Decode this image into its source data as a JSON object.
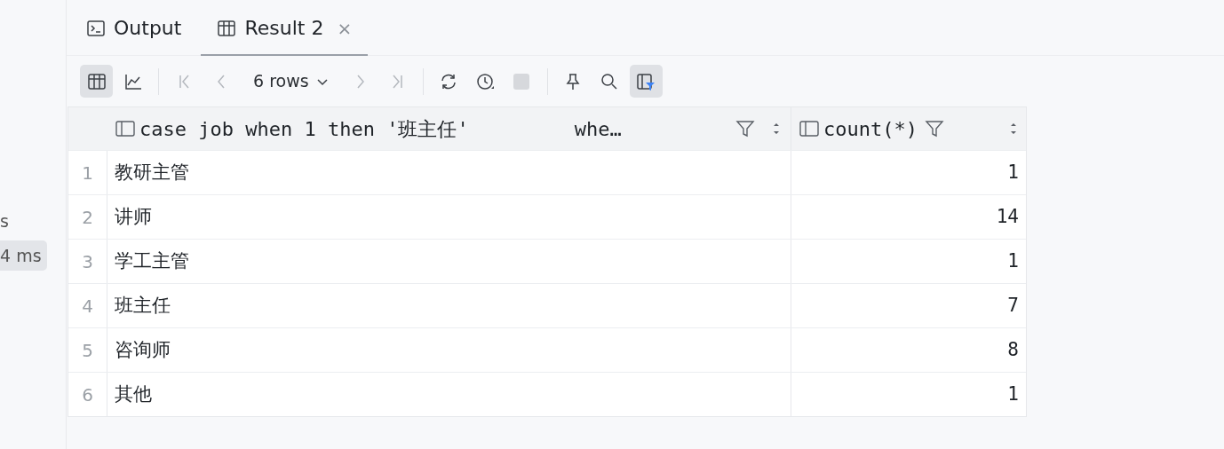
{
  "side_panel": {
    "texts": [
      {
        "text": "s",
        "kind": "plain"
      },
      {
        "text": "4 ms",
        "kind": "badge"
      }
    ]
  },
  "tabs": [
    {
      "label": "Output",
      "kind": "terminal",
      "selected": false
    },
    {
      "label": "Result 2",
      "kind": "grid",
      "selected": true,
      "close": "×"
    }
  ],
  "toolbar": [
    {
      "kind": "grid",
      "selected": true
    },
    {
      "kind": "chart",
      "selected": false
    },
    {
      "kind": "separator"
    },
    {
      "kind": "first",
      "selected": false
    },
    {
      "kind": "prev",
      "selected": false
    },
    {
      "kind": "rows",
      "label": "6 rows"
    },
    {
      "kind": "next",
      "selected": false
    },
    {
      "kind": "last",
      "selected": false
    },
    {
      "kind": "separator"
    },
    {
      "kind": "refresh",
      "selected": false
    },
    {
      "kind": "clock",
      "selected": false
    },
    {
      "kind": "stop",
      "selected": false
    },
    {
      "kind": "separator"
    },
    {
      "kind": "pin",
      "selected": false
    },
    {
      "kind": "search",
      "selected": false
    },
    {
      "kind": "filter",
      "selected": true
    }
  ],
  "table": {
    "columns": [
      {
        "label": "case job when 1 then '班主任'         whe…"
      },
      {
        "label": "count(*)"
      }
    ],
    "rows": [
      {
        "number": "1",
        "cells": [
          "教研主管",
          "1"
        ]
      },
      {
        "number": "2",
        "cells": [
          "讲师",
          "14"
        ]
      },
      {
        "number": "3",
        "cells": [
          "学工主管",
          "1"
        ]
      },
      {
        "number": "4",
        "cells": [
          "班主任",
          "7"
        ]
      },
      {
        "number": "5",
        "cells": [
          "咨询师",
          "8"
        ]
      },
      {
        "number": "6",
        "cells": [
          "其他",
          "1"
        ]
      }
    ]
  }
}
